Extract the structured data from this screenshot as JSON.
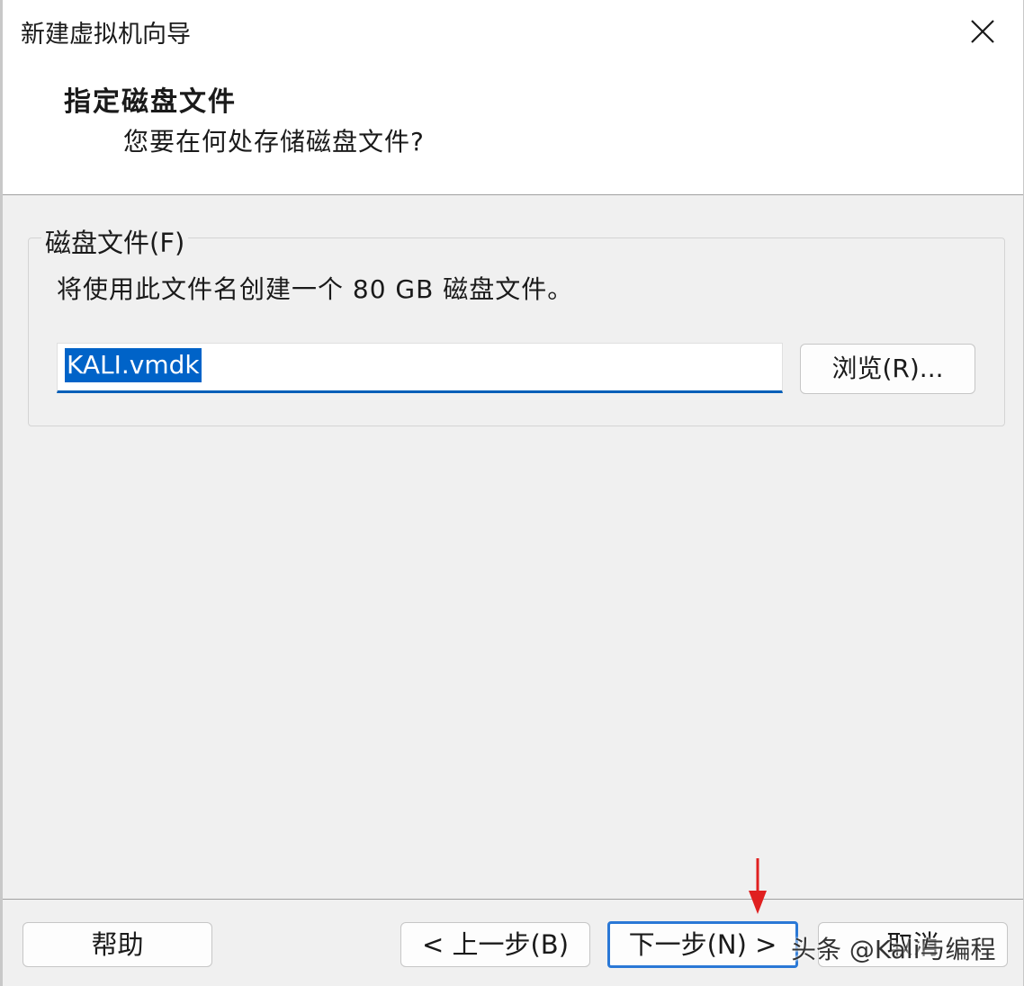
{
  "window": {
    "title": "新建虚拟机向导",
    "close_label": "×"
  },
  "header": {
    "step_title": "指定磁盘文件",
    "step_subtitle": "您要在何处存储磁盘文件?"
  },
  "disk_group": {
    "legend": "磁盘文件(F)",
    "description": "将使用此文件名创建一个 80 GB 磁盘文件。",
    "file_name_value": "KALI.vmdk",
    "browse_label": "浏览(R)..."
  },
  "footer": {
    "help_label": "帮助",
    "back_label": "< 上一步(B)",
    "next_label": "下一步(N) >",
    "cancel_label": "取消"
  },
  "watermark": "头条 @Kali与编程",
  "colors": {
    "accent": "#005fb8",
    "selection": "#0063c8",
    "annotation_arrow": "#e02020"
  }
}
